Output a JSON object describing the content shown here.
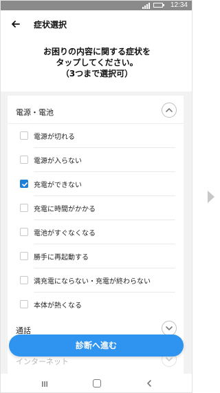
{
  "status_bar": {
    "time": "12:34"
  },
  "app_bar": {
    "title": "症状選択"
  },
  "header": {
    "line1": "お困りの内容に関する症状を",
    "line2": "タップしてください。",
    "line3": "（3つまで選択可）"
  },
  "sections": [
    {
      "title": "電源・電池",
      "expanded": true,
      "items": [
        {
          "label": "電源が切れる",
          "checked": false
        },
        {
          "label": "電源が入らない",
          "checked": false
        },
        {
          "label": "充電ができない",
          "checked": true
        },
        {
          "label": "充電に時間がかかる",
          "checked": false
        },
        {
          "label": "電池がすぐなくなる",
          "checked": false
        },
        {
          "label": "勝手に再起動する",
          "checked": false
        },
        {
          "label": "満充電にならない・充電が終わらない",
          "checked": false
        },
        {
          "label": "本体が熱くなる",
          "checked": false
        }
      ]
    },
    {
      "title": "通話",
      "expanded": false
    },
    {
      "title": "インターネット",
      "expanded": false
    }
  ],
  "cta": {
    "label": "診断へ進む"
  },
  "colors": {
    "accent": "#2f94f0",
    "checkbox_checked": "#1f7fd6"
  },
  "icons": {
    "back": "back-arrow-icon",
    "collapse": "chevron-up-icon",
    "expand": "chevron-down-icon",
    "check": "checkmark-icon",
    "next": "next-arrow-icon"
  }
}
